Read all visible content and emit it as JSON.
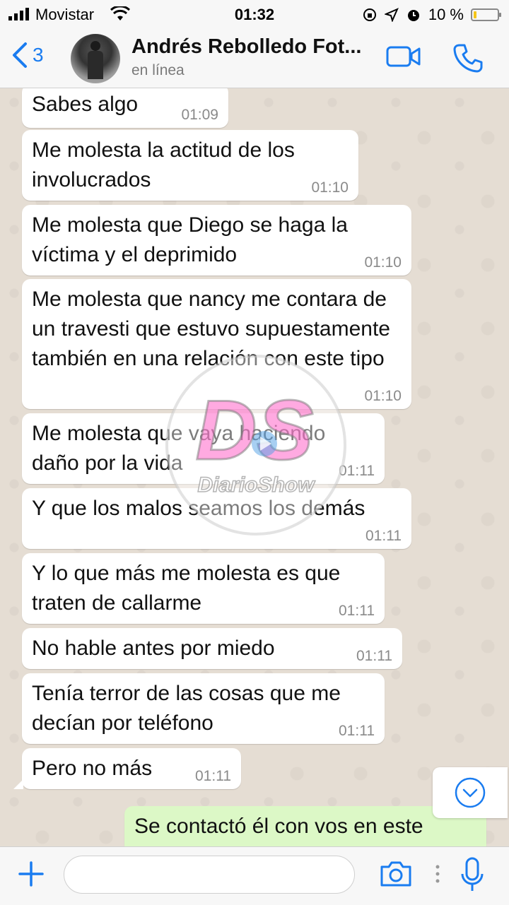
{
  "status_bar": {
    "carrier": "Movistar",
    "time": "01:32",
    "battery": "10 %",
    "battery_level": 0.1
  },
  "header": {
    "back_count": "3",
    "contact_name": "Andrés Rebolledo Fot...",
    "contact_status": "en línea"
  },
  "messages": [
    {
      "text": "Sabes algo",
      "time": "01:09"
    },
    {
      "text": "Me molesta la actitud de los involucrados",
      "time": "01:10"
    },
    {
      "text": "Me molesta que Diego se haga la víctima y el deprimido",
      "time": "01:10"
    },
    {
      "text": "Me molesta que nancy me contara de un travesti que estuvo supuestamente también en una relación con este tipo",
      "time": "01:10"
    },
    {
      "text": "Me molesta que vaya haciendo daño por la vida",
      "time": "01:11"
    },
    {
      "text": "Y que los malos seamos los demás",
      "time": "01:11"
    },
    {
      "text": "Y lo que más me molesta es que traten de callarme",
      "time": "01:11"
    },
    {
      "text": "No hable antes por miedo",
      "time": "01:11"
    },
    {
      "text": "Tenía terror de las cosas que me decían por teléfono",
      "time": "01:11"
    },
    {
      "text": "Pero no más",
      "time": "01:11"
    },
    {
      "text": "Se contactó él con vos en este",
      "time": ""
    }
  ],
  "watermark": {
    "logo": "DS",
    "name": "DiarioShow"
  },
  "input": {
    "placeholder": ""
  },
  "colors": {
    "accent": "#1a7cf0",
    "bubble_in": "#ffffff",
    "bubble_out": "#dcf8c6",
    "chat_bg": "#e5ddd3"
  }
}
